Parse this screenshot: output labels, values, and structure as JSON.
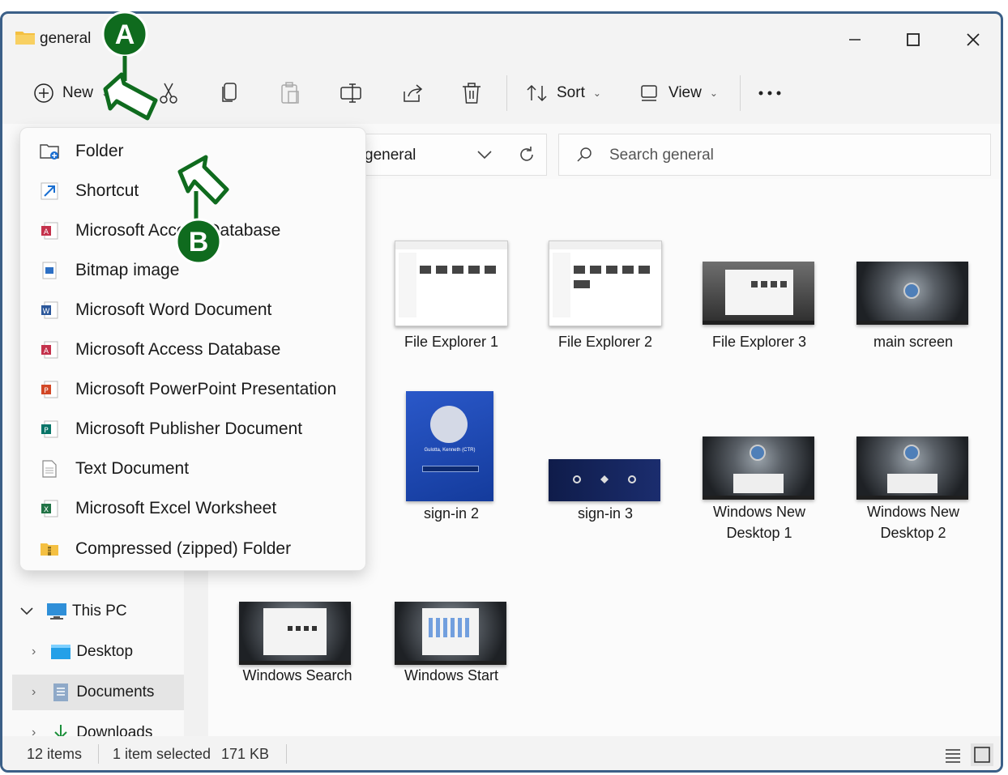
{
  "window": {
    "title": "general"
  },
  "toolbar": {
    "new_label": "New",
    "sort_label": "Sort",
    "view_label": "View"
  },
  "address": {
    "path": "general"
  },
  "search": {
    "placeholder": "Search general"
  },
  "new_menu": {
    "items": [
      {
        "label": "Folder",
        "icon": "new-folder-icon"
      },
      {
        "label": "Shortcut",
        "icon": "shortcut-icon"
      },
      {
        "label": "Microsoft Access Database",
        "icon": "access-icon"
      },
      {
        "label": "Bitmap image",
        "icon": "bitmap-icon"
      },
      {
        "label": "Microsoft Word Document",
        "icon": "word-icon"
      },
      {
        "label": "Microsoft Access Database",
        "icon": "access-icon"
      },
      {
        "label": "Microsoft PowerPoint Presentation",
        "icon": "powerpoint-icon"
      },
      {
        "label": "Microsoft Publisher Document",
        "icon": "publisher-icon"
      },
      {
        "label": "Text Document",
        "icon": "text-document-icon"
      },
      {
        "label": "Microsoft Excel Worksheet",
        "icon": "excel-icon"
      },
      {
        "label": "Compressed (zipped) Folder",
        "icon": "zip-folder-icon"
      }
    ]
  },
  "sidebar": {
    "items": [
      {
        "label": "This PC"
      },
      {
        "label": "Desktop"
      },
      {
        "label": "Documents"
      },
      {
        "label": "Downloads"
      }
    ]
  },
  "files": [
    {
      "label": "File Explorer 1"
    },
    {
      "label": "File Explorer 2"
    },
    {
      "label": "File Explorer 3"
    },
    {
      "label": "main screen"
    },
    {
      "label": "sign-in 2"
    },
    {
      "label": "sign-in 3"
    },
    {
      "label": "Windows New Desktop 1"
    },
    {
      "label": "Windows New Desktop 2"
    },
    {
      "label": "Windows Search"
    },
    {
      "label": "Windows Start"
    }
  ],
  "signin_thumb": {
    "user": "Gulotta, Kenneth (CTR)"
  },
  "status": {
    "items": "12 items",
    "selected": "1 item selected",
    "size": "171 KB"
  },
  "callouts": {
    "a": "A",
    "b": "B"
  },
  "colors": {
    "callout_green": "#0f6b1e",
    "frame_blue": "#3b5f87",
    "folder_yellow": "#f4c042"
  }
}
